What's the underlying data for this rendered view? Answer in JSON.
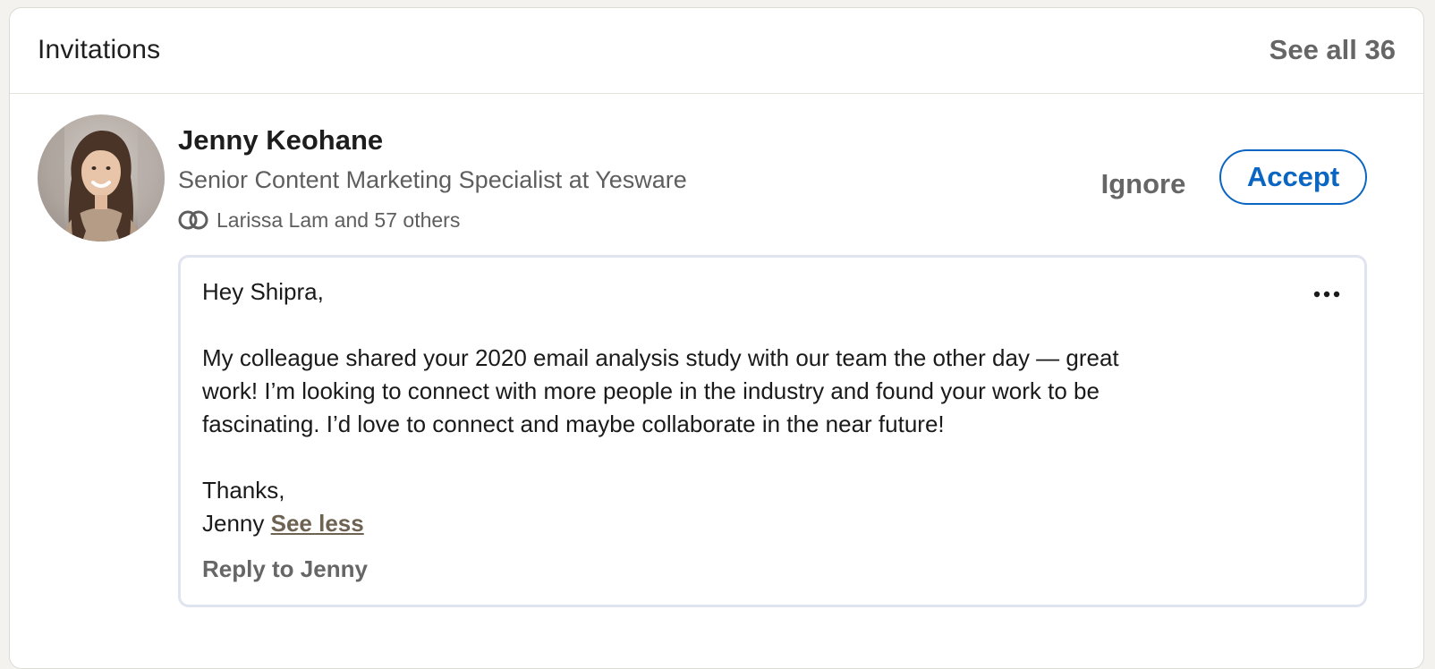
{
  "header": {
    "title": "Invitations",
    "see_all_label": "See all 36"
  },
  "invitation": {
    "avatar_icon": "person-photo",
    "name": "Jenny Keohane",
    "headline": "Senior Content Marketing Specialist at Yesware",
    "mutual_icon": "mutual-connections-icon",
    "mutual_text": "Larissa Lam and 57 others",
    "ignore_label": "Ignore",
    "accept_label": "Accept",
    "message": {
      "greeting": "Hey Shipra,",
      "body_line_1": "My colleague shared your 2020 email analysis study with our team the other day — great",
      "body_line_2": "work! I’m looking to connect with more people in the industry and found your work to be",
      "body_line_3": "fascinating. I’d love to connect and maybe collaborate in the near future!",
      "signoff": "Thanks,",
      "signature": "Jenny",
      "see_less_label": "See less",
      "reply_label": "Reply to Jenny",
      "more_icon": "more-options-icon"
    }
  },
  "colors": {
    "accent": "#0a66c2",
    "muted_text": "#666666",
    "see_less": "#6e6352"
  }
}
